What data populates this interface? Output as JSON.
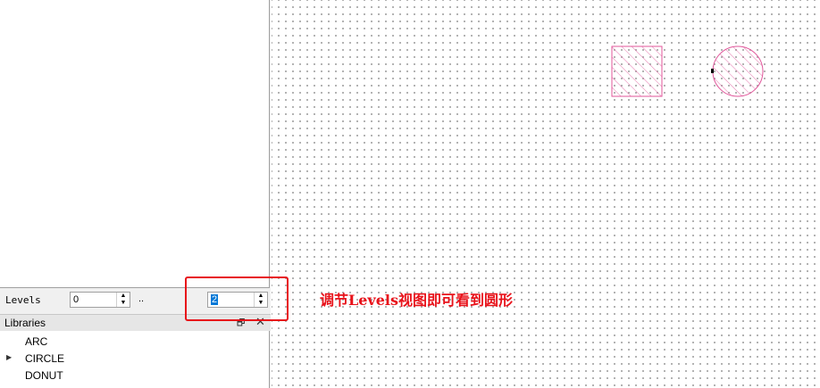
{
  "levels": {
    "label": "Levels",
    "from": "0",
    "separator": "..",
    "to": "2",
    "spin_up": "▲",
    "spin_down": "▼"
  },
  "libraries": {
    "title": "Libraries",
    "dock_icon": "🗗",
    "close_icon": "✕",
    "items": [
      {
        "label": "ARC",
        "arrow": ""
      },
      {
        "label": "CIRCLE",
        "arrow": "▶"
      },
      {
        "label": "DONUT",
        "arrow": ""
      }
    ]
  },
  "annotation": {
    "text": "调节Levels视图即可看到圆形"
  },
  "colors": {
    "shape": "#e0569a",
    "highlight": "#e8121a"
  }
}
